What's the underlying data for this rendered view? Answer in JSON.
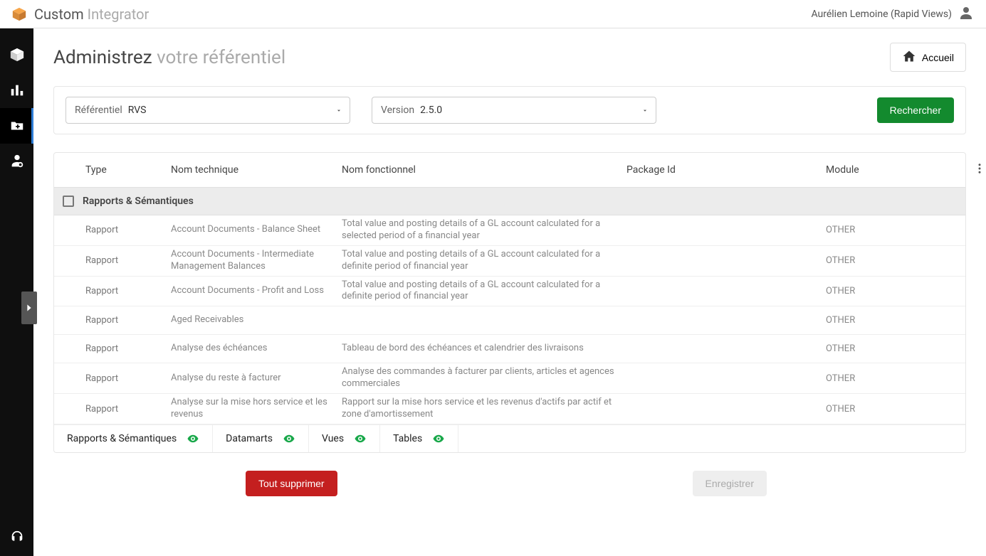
{
  "brand": {
    "name_bold": "Custom",
    "name_light": "Integrator"
  },
  "user": {
    "display": "Aurélien Lemoine (Rapid Views)"
  },
  "page": {
    "title_bold": "Administrez",
    "title_light": "votre référentiel",
    "home_label": "Accueil"
  },
  "filters": {
    "ref_label": "Référentiel",
    "ref_value": "RVS",
    "ver_label": "Version",
    "ver_value": "2.5.0",
    "search_label": "Rechercher"
  },
  "table": {
    "columns": {
      "type": "Type",
      "tech": "Nom technique",
      "fn": "Nom fonctionnel",
      "pkg": "Package Id",
      "module": "Module"
    },
    "group_title": "Rapports & Sémantiques",
    "rows": [
      {
        "type": "Rapport",
        "tech": "Account Documents - Balance Sheet",
        "fn": "Total value and posting details of a GL account calculated for a selected period of a financial year",
        "pkg": "",
        "module": "OTHER"
      },
      {
        "type": "Rapport",
        "tech": "Account Documents - Intermediate Management Balances",
        "fn": "Total value and posting details of a GL account calculated for a definite period of financial year",
        "pkg": "",
        "module": "OTHER"
      },
      {
        "type": "Rapport",
        "tech": "Account Documents - Profit and Loss",
        "fn": "Total value and posting details of a GL account calculated for a definite period of financial year",
        "pkg": "",
        "module": "OTHER"
      },
      {
        "type": "Rapport",
        "tech": "Aged Receivables",
        "fn": "",
        "pkg": "",
        "module": "OTHER"
      },
      {
        "type": "Rapport",
        "tech": "Analyse des échéances",
        "fn": "Tableau de bord des échéances et calendrier des livraisons",
        "pkg": "",
        "module": "OTHER"
      },
      {
        "type": "Rapport",
        "tech": "Analyse du reste à facturer",
        "fn": "Analyse des commandes à facturer par clients, articles et agences commerciales",
        "pkg": "",
        "module": "OTHER"
      },
      {
        "type": "Rapport",
        "tech": "Analyse sur la mise hors service et les revenus",
        "fn": "Rapport sur la mise hors service et les revenus d'actifs par actif et zone d'amortissement",
        "pkg": "",
        "module": "OTHER"
      }
    ],
    "categories": [
      {
        "label": "Rapports & Sémantiques"
      },
      {
        "label": "Datamarts"
      },
      {
        "label": "Vues"
      },
      {
        "label": "Tables"
      }
    ]
  },
  "actions": {
    "delete_all": "Tout supprimer",
    "save": "Enregistrer"
  },
  "colors": {
    "accent_green": "#138a2e",
    "danger_red": "#c41f1f",
    "eye_green": "#19a84a"
  }
}
